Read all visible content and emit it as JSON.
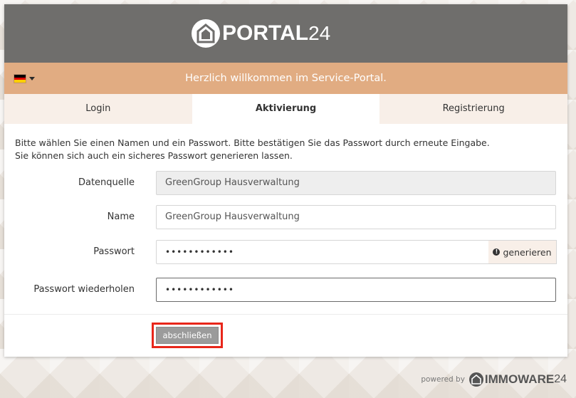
{
  "header": {
    "logo_text": "PORTAL",
    "logo_number": "24"
  },
  "welcome": {
    "text": "Herzlich willkommen im Service-Portal."
  },
  "tabs": [
    {
      "label": "Login"
    },
    {
      "label": "Aktivierung"
    },
    {
      "label": "Registrierung"
    }
  ],
  "intro": {
    "line1": "Bitte wählen Sie einen Namen und ein Passwort. Bitte bestätigen Sie das Passwort durch erneute Eingabe.",
    "line2": "Sie können sich auch ein sicheres Passwort generieren lassen."
  },
  "form": {
    "datenquelle": {
      "label": "Datenquelle",
      "value": "GreenGroup Hausverwaltung"
    },
    "name": {
      "label": "Name",
      "value": "GreenGroup Hausverwaltung"
    },
    "passwort": {
      "label": "Passwort",
      "value": "••••••••••••",
      "generate_label": "generieren"
    },
    "passwort_wiederholen": {
      "label": "Passwort wiederholen",
      "value": "••••••••••••"
    },
    "submit_label": "abschließen"
  },
  "footer": {
    "powered_by": "powered by",
    "brand_text": "IMMOWARE",
    "brand_number": "24"
  },
  "colors": {
    "header_bg": "#6f6e6c",
    "welcome_bg": "#e1ac82",
    "tab_inactive_bg": "#f8efe8",
    "highlight": "#e8261a"
  },
  "icons": {
    "language": "german-flag-icon",
    "generate": "exclamation-circle-icon"
  }
}
